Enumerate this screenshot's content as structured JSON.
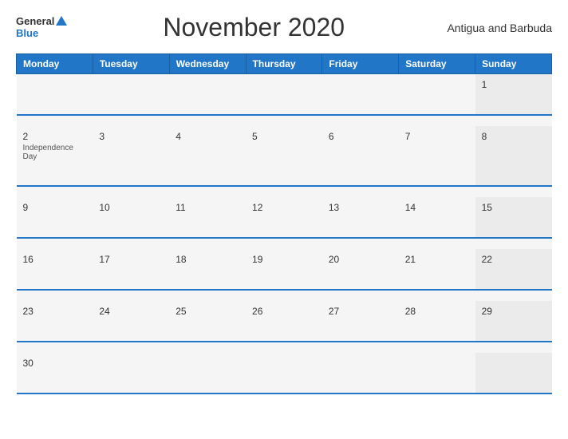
{
  "header": {
    "logo_general": "General",
    "logo_blue": "Blue",
    "title": "November 2020",
    "country": "Antigua and Barbuda"
  },
  "weekdays": [
    "Monday",
    "Tuesday",
    "Wednesday",
    "Thursday",
    "Friday",
    "Saturday",
    "Sunday"
  ],
  "weeks": [
    [
      {
        "date": "",
        "holiday": ""
      },
      {
        "date": "",
        "holiday": ""
      },
      {
        "date": "",
        "holiday": ""
      },
      {
        "date": "",
        "holiday": ""
      },
      {
        "date": "",
        "holiday": ""
      },
      {
        "date": "",
        "holiday": ""
      },
      {
        "date": "1",
        "holiday": ""
      }
    ],
    [
      {
        "date": "2",
        "holiday": "Independence Day"
      },
      {
        "date": "3",
        "holiday": ""
      },
      {
        "date": "4",
        "holiday": ""
      },
      {
        "date": "5",
        "holiday": ""
      },
      {
        "date": "6",
        "holiday": ""
      },
      {
        "date": "7",
        "holiday": ""
      },
      {
        "date": "8",
        "holiday": ""
      }
    ],
    [
      {
        "date": "9",
        "holiday": ""
      },
      {
        "date": "10",
        "holiday": ""
      },
      {
        "date": "11",
        "holiday": ""
      },
      {
        "date": "12",
        "holiday": ""
      },
      {
        "date": "13",
        "holiday": ""
      },
      {
        "date": "14",
        "holiday": ""
      },
      {
        "date": "15",
        "holiday": ""
      }
    ],
    [
      {
        "date": "16",
        "holiday": ""
      },
      {
        "date": "17",
        "holiday": ""
      },
      {
        "date": "18",
        "holiday": ""
      },
      {
        "date": "19",
        "holiday": ""
      },
      {
        "date": "20",
        "holiday": ""
      },
      {
        "date": "21",
        "holiday": ""
      },
      {
        "date": "22",
        "holiday": ""
      }
    ],
    [
      {
        "date": "23",
        "holiday": ""
      },
      {
        "date": "24",
        "holiday": ""
      },
      {
        "date": "25",
        "holiday": ""
      },
      {
        "date": "26",
        "holiday": ""
      },
      {
        "date": "27",
        "holiday": ""
      },
      {
        "date": "28",
        "holiday": ""
      },
      {
        "date": "29",
        "holiday": ""
      }
    ],
    [
      {
        "date": "30",
        "holiday": ""
      },
      {
        "date": "",
        "holiday": ""
      },
      {
        "date": "",
        "holiday": ""
      },
      {
        "date": "",
        "holiday": ""
      },
      {
        "date": "",
        "holiday": ""
      },
      {
        "date": "",
        "holiday": ""
      },
      {
        "date": "",
        "holiday": ""
      }
    ]
  ],
  "colors": {
    "header_bg": "#2176c8",
    "accent": "#2176c8"
  }
}
